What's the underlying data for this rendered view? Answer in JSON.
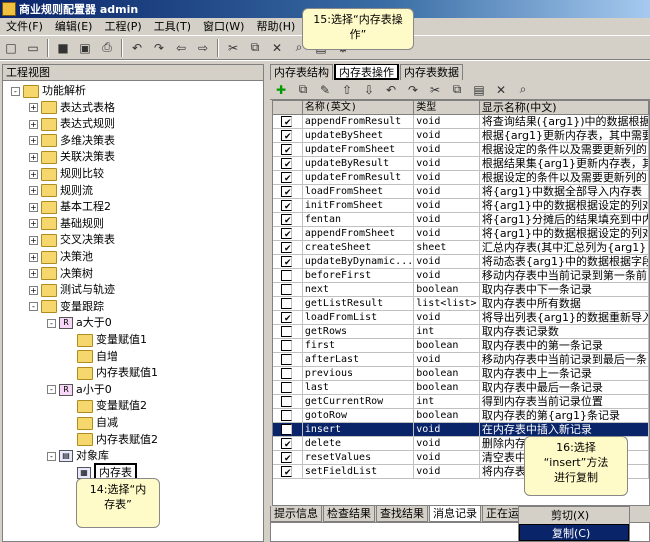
{
  "app": {
    "title": "商业规则配置器 admin"
  },
  "menu": [
    "文件(F)",
    "编辑(E)",
    "工程(P)",
    "工具(T)",
    "窗口(W)",
    "帮助(H)"
  ],
  "left_panel": {
    "title": "工程视图"
  },
  "tree": [
    {
      "label": "功能解析",
      "level": 0,
      "exp": "-",
      "icon": "folder"
    },
    {
      "label": "表达式表格",
      "level": 1,
      "exp": "+",
      "icon": "folder"
    },
    {
      "label": "表达式规则",
      "level": 1,
      "exp": "+",
      "icon": "folder"
    },
    {
      "label": "多维决策表",
      "level": 1,
      "exp": "+",
      "icon": "folder"
    },
    {
      "label": "关联决策表",
      "level": 1,
      "exp": "+",
      "icon": "folder"
    },
    {
      "label": "规则比较",
      "level": 1,
      "exp": "+",
      "icon": "folder"
    },
    {
      "label": "规则流",
      "level": 1,
      "exp": "+",
      "icon": "folder"
    },
    {
      "label": "基本工程2",
      "level": 1,
      "exp": "+",
      "icon": "folder"
    },
    {
      "label": "基础规则",
      "level": 1,
      "exp": "+",
      "icon": "folder"
    },
    {
      "label": "交叉决策表",
      "level": 1,
      "exp": "+",
      "icon": "folder"
    },
    {
      "label": "决策池",
      "level": 1,
      "exp": "+",
      "icon": "folder"
    },
    {
      "label": "决策树",
      "level": 1,
      "exp": "+",
      "icon": "folder"
    },
    {
      "label": "测试与轨迹",
      "level": 1,
      "exp": "+",
      "icon": "folder"
    },
    {
      "label": "变量跟踪",
      "level": 1,
      "exp": "-",
      "icon": "folder"
    },
    {
      "label": "a大于0",
      "level": 2,
      "exp": "-",
      "icon": "rule"
    },
    {
      "label": "变量赋值1",
      "level": 3,
      "exp": "",
      "icon": "folder"
    },
    {
      "label": "自增",
      "level": 3,
      "exp": "",
      "icon": "folder"
    },
    {
      "label": "内存表赋值1",
      "level": 3,
      "exp": "",
      "icon": "folder"
    },
    {
      "label": "a小于0",
      "level": 2,
      "exp": "-",
      "icon": "rule"
    },
    {
      "label": "变量赋值2",
      "level": 3,
      "exp": "",
      "icon": "folder"
    },
    {
      "label": "自减",
      "level": 3,
      "exp": "",
      "icon": "folder"
    },
    {
      "label": "内存表赋值2",
      "level": 3,
      "exp": "",
      "icon": "folder"
    },
    {
      "label": "对象库",
      "level": 2,
      "exp": "-",
      "icon": "db"
    },
    {
      "label": "内存表",
      "level": 3,
      "exp": "",
      "icon": "table"
    }
  ],
  "tabs": [
    "内存表结构",
    "内存表操作",
    "内存表数据"
  ],
  "columns": [
    "名称(英文)",
    "类型",
    "显示名称(中文)"
  ],
  "rows": [
    {
      "name": "appendFromResult",
      "type": "void",
      "display": "将查询结果({arg1})中的数据根据"
    },
    {
      "name": "updateBySheet",
      "type": "void",
      "display": "根据{arg1}更新内存表，其中需要"
    },
    {
      "name": "updateFromSheet",
      "type": "void",
      "display": "根据设定的条件以及需要更新列的"
    },
    {
      "name": "updateByResult",
      "type": "void",
      "display": "根据结果集{arg1}更新内存表，其"
    },
    {
      "name": "updateFromResult",
      "type": "void",
      "display": "根据设定的条件以及需要更新列的"
    },
    {
      "name": "loadFromSheet",
      "type": "void",
      "display": "将{arg1}中数据全部导入内存表"
    },
    {
      "name": "initFromSheet",
      "type": "void",
      "display": "将{arg1}中的数据根据设定的列对"
    },
    {
      "name": "fentan",
      "type": "void",
      "display": "将{arg1}分摊后的结果填充到中内"
    },
    {
      "name": "appendFromSheet",
      "type": "void",
      "display": "将{arg1}中的数据根据设定的列对"
    },
    {
      "name": "createSheet",
      "type": "sheet",
      "display": "汇总内存表(其中汇总列为{arg1}"
    },
    {
      "name": "updateByDynamic...",
      "type": "void",
      "display": "将动态表{arg1}中的数据根据字段对"
    },
    {
      "name": "beforeFirst",
      "type": "void",
      "display": "移动内存表中当前记录到第一条前"
    },
    {
      "name": "next",
      "type": "boolean",
      "display": "取内存表中下一条记录"
    },
    {
      "name": "getListResult",
      "type": "list<list>",
      "display": "取内存表中所有数据"
    },
    {
      "name": "loadFromList",
      "type": "void",
      "display": "将导出列表{arg1}的数据重新导入"
    },
    {
      "name": "getRows",
      "type": "int",
      "display": "取内存表记录数"
    },
    {
      "name": "first",
      "type": "boolean",
      "display": "取内存表中的第一条记录"
    },
    {
      "name": "afterLast",
      "type": "void",
      "display": "移动内存表中当前记录到最后一条"
    },
    {
      "name": "previous",
      "type": "boolean",
      "display": "取内存表中上一条记录"
    },
    {
      "name": "last",
      "type": "boolean",
      "display": "取内存表中最后一条记录"
    },
    {
      "name": "getCurrentRow",
      "type": "int",
      "display": "得到内存表当前记录位置"
    },
    {
      "name": "gotoRow",
      "type": "boolean",
      "display": "取内存表的第{arg1}条记录"
    },
    {
      "name": "insert",
      "type": "void",
      "display": "在内存表中插入新记录"
    },
    {
      "name": "delete",
      "type": "void",
      "display": "删除内存表中当前记录"
    },
    {
      "name": "resetValues",
      "type": "void",
      "display": "清空表中数据"
    },
    {
      "name": "setFieldList",
      "type": "void",
      "display": "将内存表的字段列表设置"
    }
  ],
  "bottom_tabs": [
    "提示信息",
    "检查结果",
    "查找结果",
    "消息记录",
    "正在运行"
  ],
  "context_menu": [
    "剪切(X)",
    "复制(C)"
  ],
  "callouts": {
    "c15": "15:选择“内存表操\n作”",
    "c14": "14:选择“内\n存表”",
    "c16": "16:选择\n“insert”方法\n进行复制"
  }
}
